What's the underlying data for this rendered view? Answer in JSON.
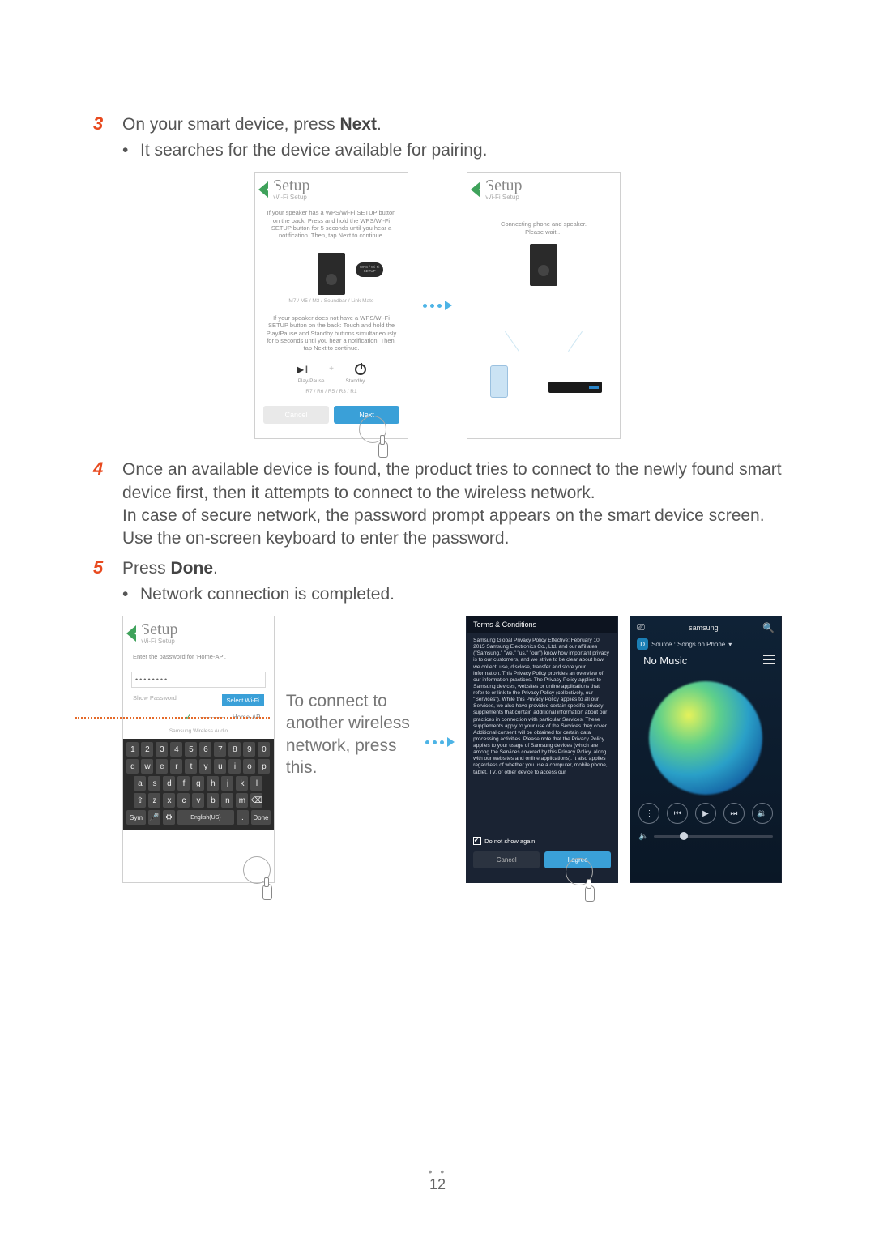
{
  "steps": {
    "s3": {
      "num": "3",
      "text_a": "On your smart device, press ",
      "text_b": "Next",
      "text_c": ".",
      "bullet": "It searches for the device available for pairing."
    },
    "s4": {
      "num": "4",
      "text": "Once an available device is found, the product tries to connect to the newly found smart device first, then it attempts to connect to the wireless network.\nIn case of secure network, the password prompt appears on the smart device screen. Use the on-screen keyboard to enter the password."
    },
    "s5": {
      "num": "5",
      "text_a": "Press ",
      "text_b": "Done",
      "text_c": ".",
      "bullet": "Network connection is completed."
    }
  },
  "annotation": "To connect to another wireless network, press this.",
  "setup_screen": {
    "title": "Setup",
    "subtitle": "Wi-Fi Setup",
    "instr1": "If your speaker has a WPS/Wi-Fi SETUP button on the back:\nPress and hold the WPS/Wi-Fi SETUP button for 5 seconds until you hear a notification. Then, tap Next to continue.",
    "wps_label": "WPS / Wi-Fi SETUP",
    "models": "M7 / M5 / M3 / Soundbar / Link Mate",
    "instr2": "If your speaker does not have a WPS/Wi-Fi SETUP button on the back:\nTouch and hold the Play/Pause and Standby buttons simultaneously for 5 seconds until you hear a notification. Then, tap Next to continue.",
    "play_label": "Play/Pause",
    "standby_label": "Standby",
    "r_series": "R7 / R6 / R5 / R3 / R1",
    "cancel": "Cancel",
    "next": "Next"
  },
  "connect_screen": {
    "title": "Setup",
    "subtitle": "Wi-Fi Setup",
    "msg": "Connecting phone and speaker.\nPlease wait…"
  },
  "pwd_screen": {
    "title": "Setup",
    "subtitle": "Wi-Fi Setup",
    "prompt": "Enter the password for 'Home-AP'.",
    "masked": "••••••••",
    "show_label": "Show Password",
    "select_wifi": "Select Wi-Fi",
    "ap_name": "Home-AP",
    "device_line": "Samsung Wireless Audio",
    "done_key": "Done",
    "sym_key": "Sym",
    "lang_key": "English(US)"
  },
  "keyboard": {
    "row1": [
      "1",
      "2",
      "3",
      "4",
      "5",
      "6",
      "7",
      "8",
      "9",
      "0"
    ],
    "row2": [
      "q",
      "w",
      "e",
      "r",
      "t",
      "y",
      "u",
      "i",
      "o",
      "p"
    ],
    "row3": [
      "a",
      "s",
      "d",
      "f",
      "g",
      "h",
      "j",
      "k",
      "l"
    ],
    "row4": [
      "⇧",
      "z",
      "x",
      "c",
      "v",
      "b",
      "n",
      "m",
      "⌫"
    ]
  },
  "terms_screen": {
    "header": "Terms & Conditions",
    "body": "Samsung Global Privacy Policy\nEffective: February 10, 2015\nSamsung Electronics Co., Ltd. and our affiliates (\"Samsung,\" \"we,\" \"us,\" \"our\") know how important privacy is to our customers, and we strive to be clear about how we collect, use, disclose, transfer and store your information. This Privacy Policy provides an overview of our information practices. The Privacy Policy applies to Samsung devices, websites or online applications that refer to or link to the Privacy Policy (collectively, our \"Services\").\nWhile this Privacy Policy applies to all our Services, we also have provided certain specific privacy supplements that contain additional information about our practices in connection with particular Services. These supplements apply to your use of the Services they cover. Additional consent will be obtained for certain data processing activities.\nPlease note that the Privacy Policy applies to your usage of Samsung devices (which are among the Services covered by this Privacy Policy, along with our websites and online applications). It also applies regardless of whether you use a computer, mobile phone, tablet, TV, or other device to access our",
    "checkbox": "Do not show again",
    "cancel": "Cancel",
    "agree": "I agree"
  },
  "player_screen": {
    "brand": "samsung",
    "source_label": "Source : Songs on Phone",
    "src_badge": "D",
    "no_music": "No Music"
  },
  "page_number": "12"
}
